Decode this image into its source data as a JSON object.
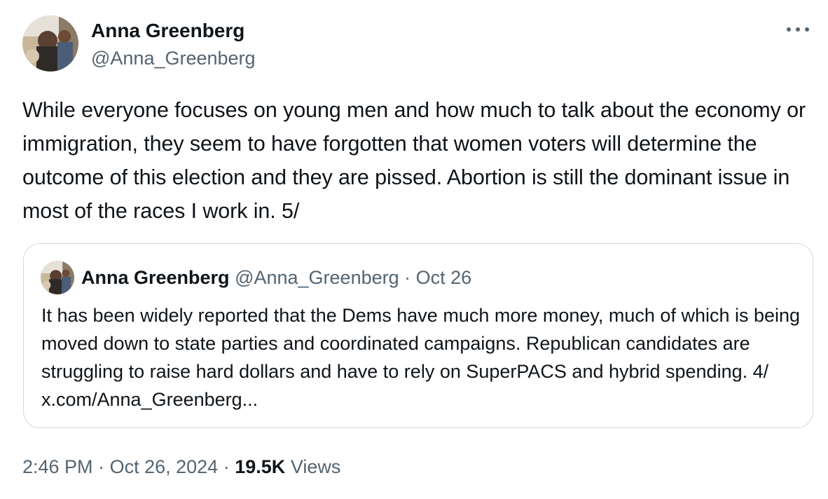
{
  "author": {
    "name": "Anna Greenberg",
    "handle": "@Anna_Greenberg"
  },
  "tweet": {
    "text": "While everyone focuses on young men and how much to talk about the economy or immigration, they seem to have forgotten that women voters will determine the outcome of this election and they are pissed. Abortion is still the dominant issue in most of the races I work in. 5/"
  },
  "quote": {
    "name": "Anna Greenberg",
    "handle": "@Anna_Greenberg",
    "separator": "·",
    "date": "Oct 26",
    "text": "It has been widely reported that the Dems have much more money, much of which is being moved down to state parties and coordinated campaigns. Republican candidates are struggling to raise hard dollars and have to rely on SuperPACS and hybrid spending. 4/ x.com/Anna_Greenberg..."
  },
  "meta": {
    "time": "2:46 PM",
    "separator": "·",
    "date": "Oct 26, 2024",
    "views_count": "19.5K",
    "views_label": "Views"
  },
  "icons": {
    "more": "more-horizontal-icon",
    "avatar": "avatar-photo"
  },
  "colors": {
    "text_primary": "#0f1419",
    "text_secondary": "#536471",
    "border": "#cfd9de"
  }
}
